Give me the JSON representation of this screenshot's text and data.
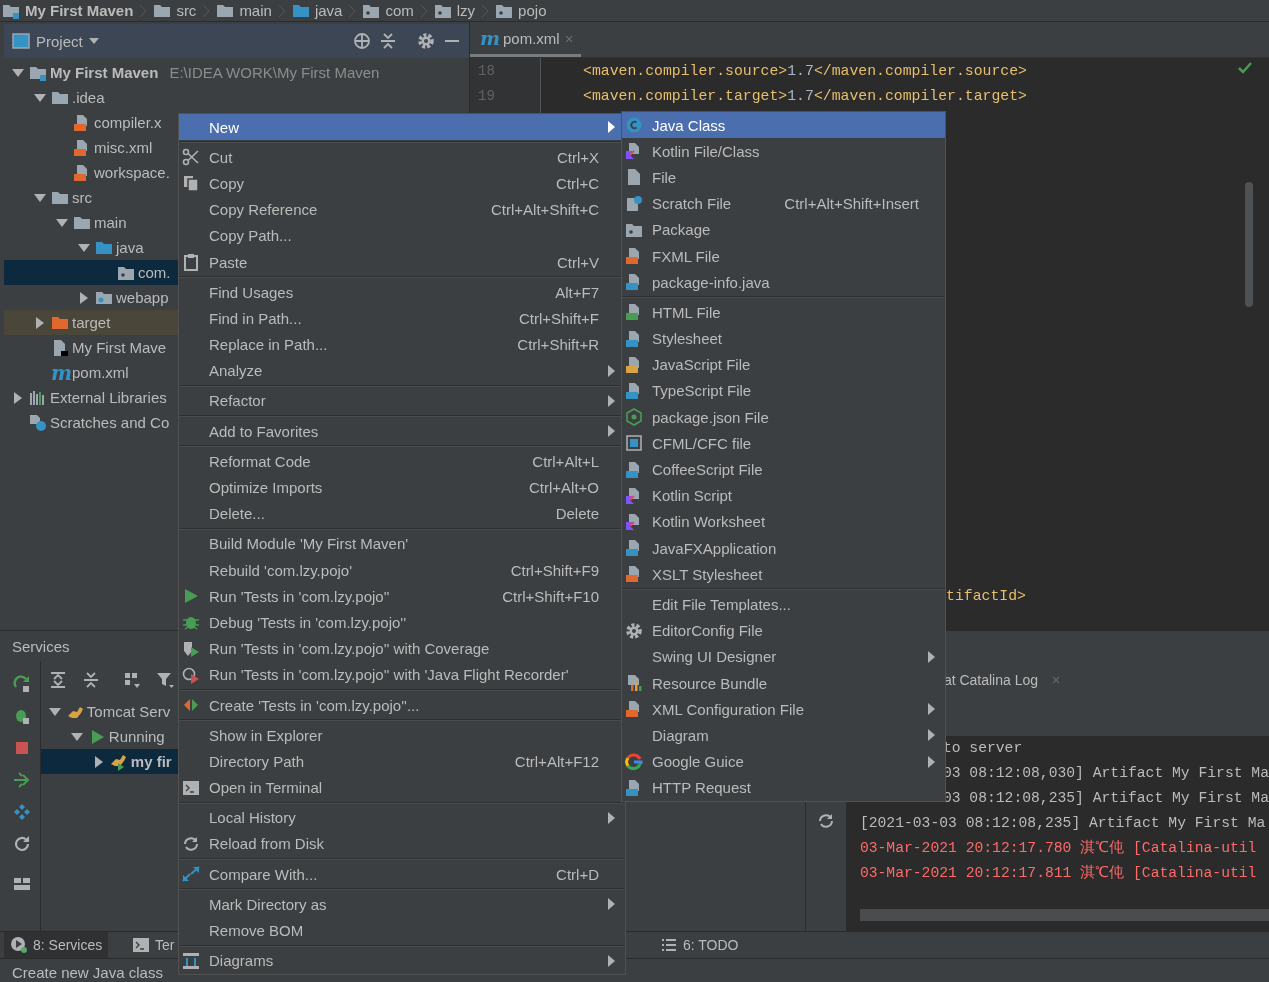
{
  "breadcrumb": [
    {
      "label": "My First Maven",
      "kind": "module"
    },
    {
      "label": "src",
      "kind": "folder"
    },
    {
      "label": "main",
      "kind": "folder"
    },
    {
      "label": "java",
      "kind": "source"
    },
    {
      "label": "com",
      "kind": "package"
    },
    {
      "label": "lzy",
      "kind": "package"
    },
    {
      "label": "pojo",
      "kind": "package"
    }
  ],
  "project_panel": {
    "title": "Project",
    "tree": [
      {
        "label": "My First Maven",
        "kind": "module",
        "hint": "E:\\IDEA WORK\\My First Maven",
        "expanded": true,
        "selected": false,
        "children": [
          {
            "label": ".idea",
            "kind": "folder",
            "expanded": true,
            "selected": false,
            "children": [
              {
                "label": "compiler.x",
                "kind": "xml",
                "selected": false
              },
              {
                "label": "misc.xml",
                "kind": "xml",
                "selected": false
              },
              {
                "label": "workspace.",
                "kind": "xml",
                "selected": false
              }
            ]
          },
          {
            "label": "src",
            "kind": "folder",
            "expanded": true,
            "selected": false,
            "children": [
              {
                "label": "main",
                "kind": "folder",
                "expanded": true,
                "selected": false,
                "children": [
                  {
                    "label": "java",
                    "kind": "source",
                    "expanded": true,
                    "selected": false,
                    "children": [
                      {
                        "label": "com.",
                        "kind": "package",
                        "selected": true
                      }
                    ]
                  },
                  {
                    "label": "webapp",
                    "kind": "web",
                    "expanded": false,
                    "selected": false
                  }
                ]
              }
            ]
          },
          {
            "label": "target",
            "kind": "excluded",
            "expanded": false,
            "selected": false
          },
          {
            "label": "My First Mave",
            "kind": "iml",
            "selected": false
          },
          {
            "label": "pom.xml",
            "kind": "maven",
            "glyph": "m",
            "selected": false
          }
        ]
      },
      {
        "label": "External Libraries",
        "kind": "libraries",
        "expanded": false,
        "selected": false
      },
      {
        "label": "Scratches and Co",
        "kind": "scratches",
        "selected": false
      }
    ]
  },
  "editor": {
    "tab": {
      "glyph": "m",
      "label": "pom.xml",
      "close": "×",
      "selected": true
    },
    "lines": [
      {
        "number": "18",
        "code": [
          {
            "text": "<maven.compiler.source>",
            "kind": "tag"
          },
          {
            "text": "1.7",
            "kind": "value"
          },
          {
            "text": "</maven.compiler.source>",
            "kind": "tag"
          }
        ]
      },
      {
        "number": "19",
        "code": [
          {
            "text": "<maven.compiler.target>",
            "kind": "tag"
          },
          {
            "text": "1.7",
            "kind": "value"
          },
          {
            "text": "</maven.compiler.target>",
            "kind": "tag"
          }
        ]
      }
    ],
    "partial_line": "tifactId>"
  },
  "services": {
    "title": "Services",
    "tree": [
      {
        "label": "Tomcat Serv",
        "kind": "cat",
        "expanded": true,
        "selected": false,
        "children": [
          {
            "label": "Running",
            "kind": "run",
            "expanded": true,
            "selected": false,
            "children": [
              {
                "label": "my fir",
                "kind": "artifact",
                "expanded": false,
                "selected": true
              }
            ]
          }
        ]
      }
    ],
    "log_tab": {
      "label": "at Catalina Log",
      "close": "×",
      "selected": true
    },
    "log": [
      {
        "text": "to server",
        "kind": "covered"
      },
      {
        "text": "03 08:12:08,030] Artifact My First Ma",
        "kind": "covered"
      },
      {
        "text": "03 08:12:08,235] Artifact My First Ma",
        "kind": "covered"
      },
      {
        "text": "[2021-03-03 08:12:08,235] Artifact My First Ma",
        "kind": "info"
      },
      {
        "text": "03-Mar-2021 20:12:17.780 淇℃伅 [Catalina-util",
        "kind": "error"
      },
      {
        "text": "03-Mar-2021 20:12:17.811 淇℃伅 [Catalina-util",
        "kind": "error"
      }
    ]
  },
  "tool_tabs": [
    {
      "label": "8: Services",
      "kind": "services",
      "selected": true
    },
    {
      "label": "Ter",
      "kind": "terminal",
      "selected": false
    },
    {
      "label": "6: TODO",
      "kind": "list",
      "selected": false
    }
  ],
  "status_bar": "Create new Java class",
  "context_menu": [
    {
      "kind": "plain",
      "label": "New",
      "submenu": true,
      "selected": true
    },
    {
      "kind": "separator"
    },
    {
      "kind": "scissors",
      "label": "Cut",
      "shortcut": "Ctrl+X",
      "submenu": false,
      "selected": false
    },
    {
      "kind": "copy",
      "label": "Copy",
      "shortcut": "Ctrl+C",
      "submenu": false,
      "selected": false
    },
    {
      "kind": "plain",
      "label": "Copy Reference",
      "shortcut": "Ctrl+Alt+Shift+C",
      "submenu": false,
      "selected": false
    },
    {
      "kind": "plain",
      "label": "Copy Path...",
      "submenu": false,
      "selected": false
    },
    {
      "kind": "paste",
      "label": "Paste",
      "shortcut": "Ctrl+V",
      "submenu": false,
      "selected": false
    },
    {
      "kind": "separator"
    },
    {
      "kind": "plain",
      "label": "Find Usages",
      "shortcut": "Alt+F7",
      "submenu": false,
      "selected": false
    },
    {
      "kind": "plain",
      "label": "Find in Path...",
      "shortcut": "Ctrl+Shift+F",
      "submenu": false,
      "selected": false
    },
    {
      "kind": "plain",
      "label": "Replace in Path...",
      "shortcut": "Ctrl+Shift+R",
      "submenu": false,
      "selected": false
    },
    {
      "kind": "plain",
      "label": "Analyze",
      "submenu": true,
      "selected": false
    },
    {
      "kind": "separator"
    },
    {
      "kind": "plain",
      "label": "Refactor",
      "submenu": true,
      "selected": false
    },
    {
      "kind": "separator"
    },
    {
      "kind": "plain",
      "label": "Add to Favorites",
      "submenu": true,
      "selected": false
    },
    {
      "kind": "separator"
    },
    {
      "kind": "plain",
      "label": "Reformat Code",
      "shortcut": "Ctrl+Alt+L",
      "submenu": false,
      "selected": false
    },
    {
      "kind": "plain",
      "label": "Optimize Imports",
      "shortcut": "Ctrl+Alt+O",
      "submenu": false,
      "selected": false
    },
    {
      "kind": "plain",
      "label": "Delete...",
      "shortcut": "Delete",
      "submenu": false,
      "selected": false
    },
    {
      "kind": "separator"
    },
    {
      "kind": "plain",
      "label": "Build Module 'My First Maven'",
      "submenu": false,
      "selected": false
    },
    {
      "kind": "plain",
      "label": "Rebuild 'com.lzy.pojo'",
      "shortcut": "Ctrl+Shift+F9",
      "submenu": false,
      "selected": false
    },
    {
      "kind": "run",
      "label": "Run 'Tests in 'com.lzy.pojo''",
      "shortcut": "Ctrl+Shift+F10",
      "submenu": false,
      "selected": false
    },
    {
      "kind": "debug",
      "label": "Debug 'Tests in 'com.lzy.pojo''",
      "submenu": false,
      "selected": false
    },
    {
      "kind": "coverage",
      "label": "Run 'Tests in 'com.lzy.pojo'' with Coverage",
      "submenu": false,
      "selected": false
    },
    {
      "kind": "profiler",
      "label": "Run 'Tests in 'com.lzy.pojo'' with 'Java Flight Recorder'",
      "submenu": false,
      "selected": false
    },
    {
      "kind": "separator"
    },
    {
      "kind": "create",
      "label": "Create 'Tests in 'com.lzy.pojo''...",
      "submenu": false,
      "selected": false
    },
    {
      "kind": "separator"
    },
    {
      "kind": "plain",
      "label": "Show in Explorer",
      "submenu": false,
      "selected": false
    },
    {
      "kind": "plain",
      "label": "Directory Path",
      "shortcut": "Ctrl+Alt+F12",
      "submenu": false,
      "selected": false
    },
    {
      "kind": "terminal",
      "label": "Open in Terminal",
      "submenu": false,
      "selected": false
    },
    {
      "kind": "separator"
    },
    {
      "kind": "plain",
      "label": "Local History",
      "submenu": true,
      "selected": false
    },
    {
      "kind": "reload",
      "label": "Reload from Disk",
      "submenu": false,
      "selected": false
    },
    {
      "kind": "separator"
    },
    {
      "kind": "compare",
      "label": "Compare With...",
      "shortcut": "Ctrl+D",
      "submenu": false,
      "selected": false
    },
    {
      "kind": "separator"
    },
    {
      "kind": "plain",
      "label": "Mark Directory as",
      "submenu": true,
      "selected": false
    },
    {
      "kind": "plain",
      "label": "Remove BOM",
      "submenu": false,
      "selected": false
    },
    {
      "kind": "separator"
    },
    {
      "kind": "diagram",
      "label": "Diagrams",
      "submenu": true,
      "selected": false
    }
  ],
  "new_submenu": [
    {
      "kind": "class",
      "label": "Java Class",
      "submenu": false,
      "selected": true
    },
    {
      "kind": "kotlin",
      "label": "Kotlin File/Class",
      "submenu": false,
      "selected": false
    },
    {
      "kind": "file",
      "label": "File",
      "submenu": false,
      "selected": false
    },
    {
      "kind": "scratch",
      "label": "Scratch File",
      "shortcut": "Ctrl+Alt+Shift+Insert",
      "submenu": false,
      "selected": false
    },
    {
      "kind": "package",
      "label": "Package",
      "submenu": false,
      "selected": false
    },
    {
      "kind": "xml",
      "label": "FXML File",
      "submenu": false,
      "selected": false
    },
    {
      "kind": "javafile",
      "label": "package-info.java",
      "submenu": false,
      "selected": false
    },
    {
      "kind": "separator"
    },
    {
      "kind": "html",
      "label": "HTML File",
      "submenu": false,
      "selected": false
    },
    {
      "kind": "css",
      "label": "Stylesheet",
      "submenu": false,
      "selected": false
    },
    {
      "kind": "js",
      "label": "JavaScript File",
      "submenu": false,
      "selected": false
    },
    {
      "kind": "ts",
      "label": "TypeScript File",
      "submenu": false,
      "selected": false
    },
    {
      "kind": "node",
      "label": "package.json File",
      "submenu": false,
      "selected": false
    },
    {
      "kind": "cfml",
      "label": "CFML/CFC file",
      "submenu": false,
      "selected": false
    },
    {
      "kind": "coffee",
      "label": "CoffeeScript File",
      "submenu": false,
      "selected": false
    },
    {
      "kind": "kotlin",
      "label": "Kotlin Script",
      "submenu": false,
      "selected": false
    },
    {
      "kind": "kotlin",
      "label": "Kotlin Worksheet",
      "submenu": false,
      "selected": false
    },
    {
      "kind": "javafile",
      "label": "JavaFXApplication",
      "submenu": false,
      "selected": false
    },
    {
      "kind": "xml",
      "label": "XSLT Stylesheet",
      "submenu": false,
      "selected": false
    },
    {
      "kind": "separator"
    },
    {
      "kind": "plain",
      "label": "Edit File Templates...",
      "submenu": false,
      "selected": false
    },
    {
      "kind": "gear",
      "label": "EditorConfig File",
      "submenu": false,
      "selected": false
    },
    {
      "kind": "plain",
      "label": "Swing UI Designer",
      "submenu": true,
      "selected": false
    },
    {
      "kind": "bundle",
      "label": "Resource Bundle",
      "submenu": false,
      "selected": false
    },
    {
      "kind": "xml",
      "label": "XML Configuration File",
      "submenu": true,
      "selected": false
    },
    {
      "kind": "plain",
      "label": "Diagram",
      "submenu": true,
      "selected": false
    },
    {
      "kind": "google",
      "label": "Google Guice",
      "submenu": true,
      "selected": false
    },
    {
      "kind": "api",
      "label": "HTTP Request",
      "submenu": false,
      "selected": false
    }
  ]
}
